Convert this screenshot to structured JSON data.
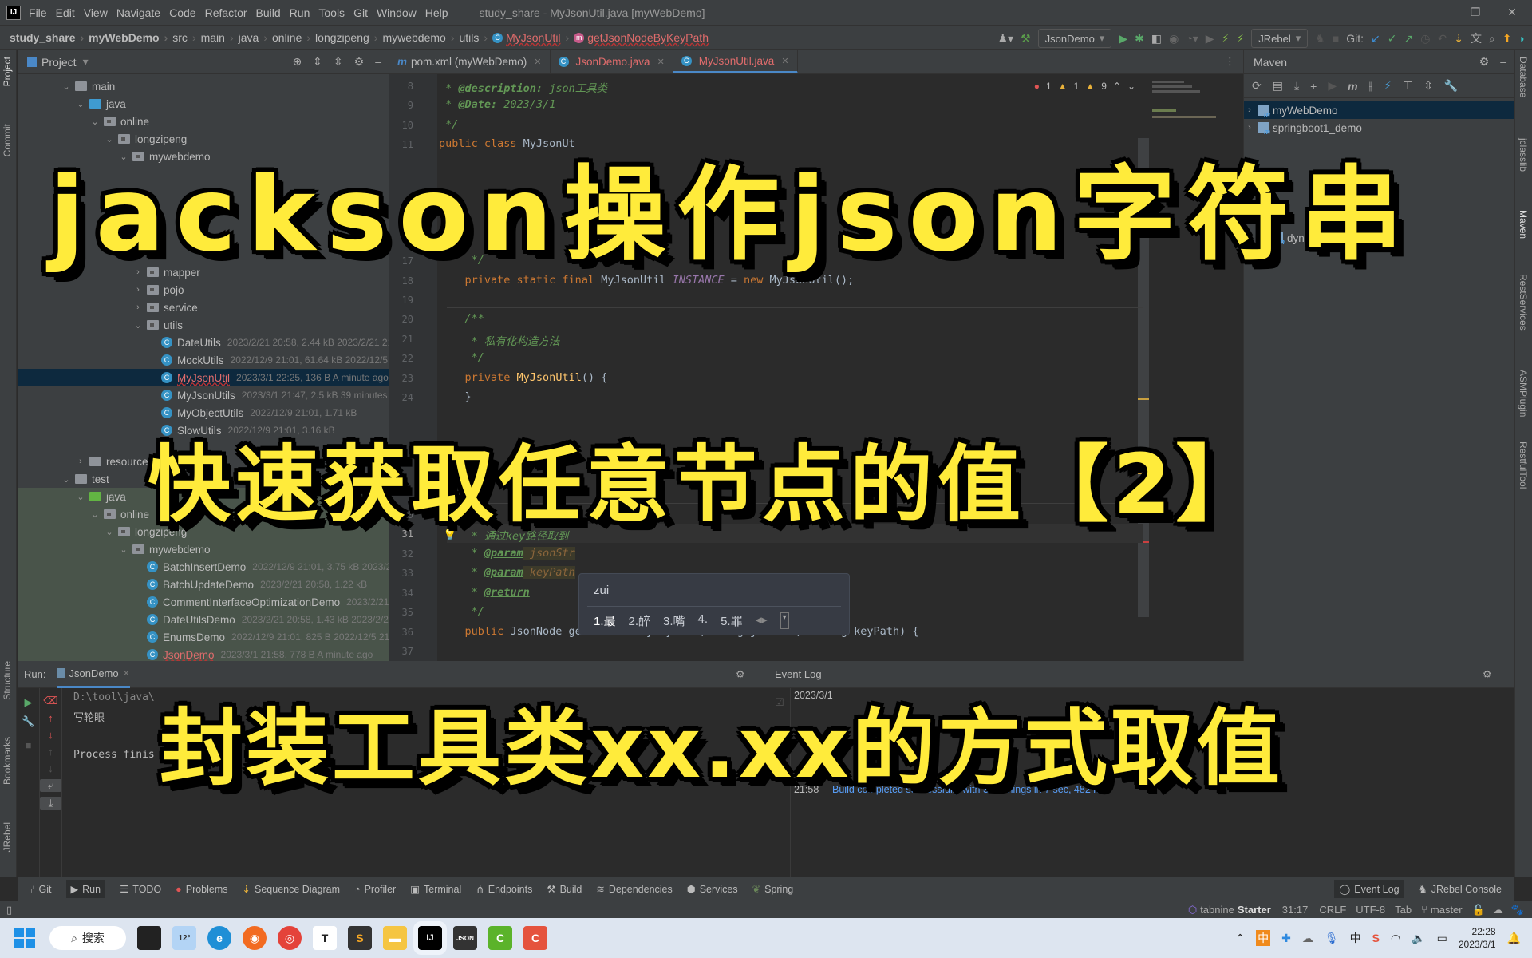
{
  "titlebar": {
    "logo": "IJ",
    "menu": [
      "File",
      "Edit",
      "View",
      "Navigate",
      "Code",
      "Refactor",
      "Build",
      "Run",
      "Tools",
      "Git",
      "Window",
      "Help"
    ],
    "window_title": "study_share - MyJsonUtil.java [myWebDemo]",
    "controls": [
      "–",
      "❐",
      "✕"
    ]
  },
  "navbar": {
    "breadcrumbs": [
      "study_share",
      "myWebDemo",
      "src",
      "main",
      "java",
      "online",
      "longzipeng",
      "mywebdemo",
      "utils",
      "MyJsonUtil",
      "getJsonNodeByKeyPath"
    ],
    "run_config": "JsonDemo",
    "jrebel": "JRebel",
    "git_label": "Git:"
  },
  "project": {
    "title": "Project",
    "tree": [
      {
        "label": "main",
        "indent": 3,
        "arrow": "⌄",
        "icon": "folder"
      },
      {
        "label": "java",
        "indent": 4,
        "arrow": "⌄",
        "icon": "folder-blue"
      },
      {
        "label": "online",
        "indent": 5,
        "arrow": "⌄",
        "icon": "package"
      },
      {
        "label": "longzipeng",
        "indent": 6,
        "arrow": "⌄",
        "icon": "package"
      },
      {
        "label": "mywebdemo",
        "indent": 7,
        "arrow": "⌄",
        "icon": "package"
      },
      {
        "label": "mapper",
        "indent": 8,
        "arrow": "›",
        "icon": "package"
      },
      {
        "label": "pojo",
        "indent": 8,
        "arrow": "›",
        "icon": "package"
      },
      {
        "label": "service",
        "indent": 8,
        "arrow": "›",
        "icon": "package"
      },
      {
        "label": "utils",
        "indent": 8,
        "arrow": "⌄",
        "icon": "package"
      },
      {
        "label": "DateUtils",
        "meta": "2023/2/21 20:58, 2.44 kB 2023/2/21 21:"
      },
      {
        "label": "MockUtils",
        "meta": "2022/12/9 21:01, 61.64 kB 2022/12/5"
      },
      {
        "label": "MyJsonUtil",
        "meta": "2023/3/1 22:25, 136 B A minute ago"
      },
      {
        "label": "MyJsonUtils",
        "meta": "2023/3/1 21:47, 2.5 kB 39 minutes a"
      },
      {
        "label": "MyObjectUtils",
        "meta": "2022/12/9 21:01, 1.71 kB"
      },
      {
        "label": "SlowUtils",
        "meta": "2022/12/9 21:01, 3.16 kB"
      },
      {
        "label": "resources"
      },
      {
        "label": "test"
      },
      {
        "label": "java"
      },
      {
        "label": "online"
      },
      {
        "label": "longzipeng"
      },
      {
        "label": "mywebdemo"
      },
      {
        "label": "BatchInsertDemo",
        "meta": "2022/12/9 21:01, 3.75 kB 2023/2/"
      },
      {
        "label": "BatchUpdateDemo",
        "meta": "2023/2/21 20:58, 1.22 kB"
      },
      {
        "label": "CommentInterfaceOptimizationDemo",
        "meta": "2023/2/21"
      },
      {
        "label": "DateUtilsDemo",
        "meta": "2023/2/21 20:58, 1.43 kB 2023/2/21"
      },
      {
        "label": "EnumsDemo",
        "meta": "2022/12/9 21:01, 825 B 2022/12/5 21:0"
      },
      {
        "label": "JsonDemo",
        "meta": "2023/3/1 21:58, 778 B A minute ago"
      }
    ]
  },
  "editor": {
    "tabs": [
      {
        "label": "pom.xml (myWebDemo)",
        "icon": "m"
      },
      {
        "label": "JsonDemo.java",
        "icon": "c"
      },
      {
        "label": "MyJsonUtil.java",
        "icon": "c"
      }
    ],
    "inspections": {
      "errors": "1",
      "warnings": "1",
      "weak_warnings": "9"
    },
    "lines": {
      "l8": {
        "num": "8",
        "star": " * ",
        "tag": "@description:",
        "text": " json工具类"
      },
      "l9": {
        "num": "9",
        "star": " * ",
        "tag": "@Date:",
        "text": " 2023/3/1"
      },
      "l10": {
        "num": "10",
        "text": " */"
      },
      "l11": {
        "num": "11",
        "kw": "public class ",
        "text": "MyJsonUt"
      },
      "l17": {
        "num": "17",
        "text": "     */"
      },
      "l18": {
        "num": "18",
        "kw1": "private static final ",
        "type": "MyJsonUtil ",
        "const": "INSTANCE",
        "eq": " = ",
        "kw2": "new ",
        "text": "MyJsonUtil();"
      },
      "l19": {
        "num": "19"
      },
      "l20": {
        "num": "20",
        "text": "    /**"
      },
      "l21": {
        "num": "21",
        "text": "     * 私有化构造方法"
      },
      "l22": {
        "num": "22",
        "text": "     */"
      },
      "l23": {
        "num": "23",
        "kw": "private ",
        "fn": "MyJsonUtil",
        "text": "() {"
      },
      "l24": {
        "num": "24",
        "text": "    }"
      },
      "l30": {
        "num": "30",
        "text": "    /**"
      },
      "l31": {
        "num": "31",
        "text": "     * 通过key路径取到"
      },
      "l32": {
        "num": "32",
        "star": "     * ",
        "tag": "@param",
        "pv": " jsonStr"
      },
      "l33": {
        "num": "33",
        "star": "     * ",
        "tag": "@param",
        "pv": " keyPath"
      },
      "l34": {
        "num": "34",
        "star": "     * ",
        "tag": "@return"
      },
      "l35": {
        "num": "35",
        "text": "     */"
      },
      "l36": {
        "num": "36",
        "kw": "    public ",
        "text": "JsonNode getJsonNodeByKeyPath(String jsonStr, String keyPath) {"
      },
      "l37": {
        "num": "37"
      }
    }
  },
  "ime": {
    "typed": "zui",
    "candidates": [
      "1.最",
      "2.醉",
      "3.嘴",
      "4.",
      "5.罪"
    ]
  },
  "maven": {
    "title": "Maven",
    "projects": [
      "myWebDemo",
      "springboot1_demo",
      "dynamic-datasource"
    ]
  },
  "run": {
    "label": "Run:",
    "tab": "JsonDemo",
    "output": [
      "D:\\tool\\java\\",
      "写轮眼",
      "",
      "Process finis"
    ]
  },
  "eventlog": {
    "title": "Event Log",
    "date": "2023/3/1",
    "time": "21:58",
    "message": "Build completed successfully with 3 warnings in 7 sec, 482 ms"
  },
  "bottom_tabs": [
    "Git",
    "Run",
    "TODO",
    "Problems",
    "Sequence Diagram",
    "Profiler",
    "Terminal",
    "Endpoints",
    "Build",
    "Dependencies",
    "Services",
    "Spring"
  ],
  "bottom_right_tabs": [
    "Event Log",
    "JRebel Console"
  ],
  "statusbar": {
    "tabnine": "tabnine",
    "tabnine_plan": "Starter",
    "position": "31:17",
    "line_sep": "CRLF",
    "encoding": "UTF-8",
    "indent": "Tab",
    "branch": "master"
  },
  "left_tools": [
    "Project",
    "Commit",
    "Structure",
    "Bookmarks",
    "JRebel"
  ],
  "right_tools": [
    "Database",
    "jclasslib",
    "Maven",
    "RestServices",
    "ASMPlugin",
    "RestfulTool"
  ],
  "taskbar": {
    "search": "搜索",
    "weather": "12°",
    "time": "22:28",
    "date": "2023/3/1",
    "ime_tray": "中"
  },
  "overlay": {
    "title": "jackson操作json字符串",
    "subtitle": "快速获取任意节点的值【2】",
    "caption": "封装工具类xx.xx的方式取值"
  },
  "colors": {
    "overlay_text": "#ffeb3b",
    "overlay_outline": "#000000",
    "accent": "#4a88c7",
    "error": "#e06c6c"
  }
}
